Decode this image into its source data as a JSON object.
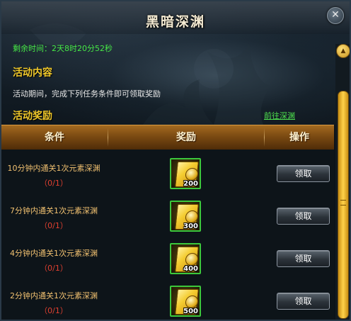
{
  "window": {
    "title": "黑暗深渊",
    "close_symbol": "✕"
  },
  "event": {
    "remaining_time": "剩余时间：2天8时20分52秒",
    "content_heading": "活动内容",
    "content_text": "活动期间，完成下列任务条件即可领取奖励",
    "reward_heading": "活动奖励",
    "goto_link": "前往深渊"
  },
  "table": {
    "headers": [
      "条件",
      "奖励",
      "操作"
    ],
    "rows": [
      {
        "condition": "10分钟内通关1次元素深渊",
        "progress": "（0/1）",
        "reward_qty": "200",
        "action": "领取"
      },
      {
        "condition": "7分钟内通关1次元素深渊",
        "progress": "（0/1）",
        "reward_qty": "300",
        "action": "领取"
      },
      {
        "condition": "4分钟内通关1次元素深渊",
        "progress": "（0/1）",
        "reward_qty": "400",
        "action": "领取"
      },
      {
        "condition": "2分钟内通关1次元素深渊",
        "progress": "（0/1）",
        "reward_qty": "500",
        "action": "领取"
      }
    ]
  },
  "colors": {
    "accent_gold": "#f0c82a",
    "timer_green": "#46e846",
    "progress_red": "#e04030",
    "header_brown": "#7b4a12"
  },
  "icons": {
    "reward": "gold-ticket-icon",
    "scroll_up": "scroll-up-arrow-icon"
  }
}
